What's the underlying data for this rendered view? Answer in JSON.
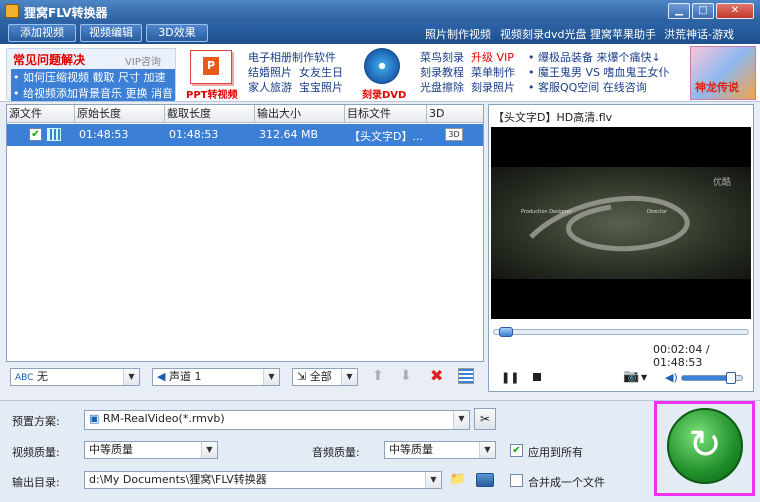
{
  "window": {
    "title": "狸窝FLV转换器"
  },
  "menubar": {
    "buttons": [
      "添加视频",
      "视频编辑",
      "3D效果"
    ],
    "links": [
      "照片制作视频",
      "视频刻录dvd光盘",
      "狸窝苹果助手",
      "洪荒神话-游戏"
    ]
  },
  "banner": {
    "faq_title": "常见问题解决",
    "faq_vip": "VIP咨询",
    "faq_items": [
      "• 如何压缩视频",
      "截取",
      "尺寸",
      "加速",
      "• 给视频添加背景音乐",
      "更换",
      "消音"
    ],
    "ppt_label": "PPT转视频",
    "col2": [
      "电子相册制作软件",
      "结婚照片",
      "女友生日",
      "家人旅游",
      "宝宝照片"
    ],
    "dvd_label": "刻录DVD",
    "col3": [
      "菜鸟刻录",
      "升级 VIP",
      "刻录教程",
      "菜单制作",
      "光盘擦除",
      "刻录照片"
    ],
    "col4": [
      "• 爆极品装备  来爆个痛快↓",
      "• 魔王鬼男 VS 嗜血鬼王女仆",
      "• 客服QQ空间  在线咨询"
    ],
    "game_label": "神龙传说"
  },
  "filelist": {
    "headers": [
      "源文件",
      "原始长度",
      "截取长度",
      "输出大小",
      "目标文件",
      "3D"
    ],
    "rows": [
      {
        "orig": "01:48:53",
        "cut": "01:48:53",
        "size": "312.64 MB",
        "target": "【头文字D】..."
      }
    ]
  },
  "filetool": {
    "subtitle": "无",
    "audio": "声道 1",
    "range": "全部"
  },
  "preview": {
    "filename": "【头文字D】HD高清.flv",
    "time": "00:02:04 / 01:48:53",
    "watermark": "优酷",
    "credit1": "Production Designer",
    "credit2": "Director",
    "progress": 0.02
  },
  "settings": {
    "preset_label": "预置方案:",
    "preset_value": "RM-RealVideo(*.rmvb)",
    "vq_label": "视频质量:",
    "vq_value": "中等质量",
    "aq_label": "音频质量:",
    "aq_value": "中等质量",
    "apply_all": "应用到所有",
    "out_label": "输出目录:",
    "out_value": "d:\\My Documents\\狸窝\\FLV转换器",
    "merge": "合并成一个文件"
  }
}
